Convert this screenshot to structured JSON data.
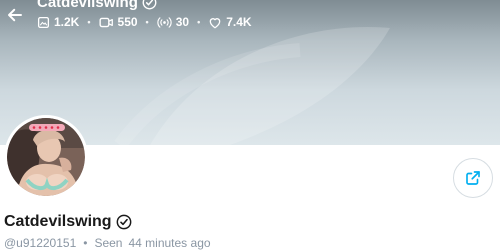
{
  "header": {
    "title": "Catdevilswing",
    "verified_icon": "verified-check-icon",
    "back_icon": "arrow-left-icon"
  },
  "stats": [
    {
      "icon": "image-icon",
      "value": "1.2K"
    },
    {
      "icon": "video-icon",
      "value": "550"
    },
    {
      "icon": "broadcast-icon",
      "value": "30"
    },
    {
      "icon": "heart-icon",
      "value": "7.4K"
    }
  ],
  "profile": {
    "name": "Catdevilswing",
    "username": "@u91220151",
    "seen_label": "Seen",
    "seen_time": "44 minutes ago"
  },
  "share": {
    "icon": "share-icon"
  },
  "colors": {
    "accent": "#00aff0",
    "muted": "#8a96a3"
  }
}
